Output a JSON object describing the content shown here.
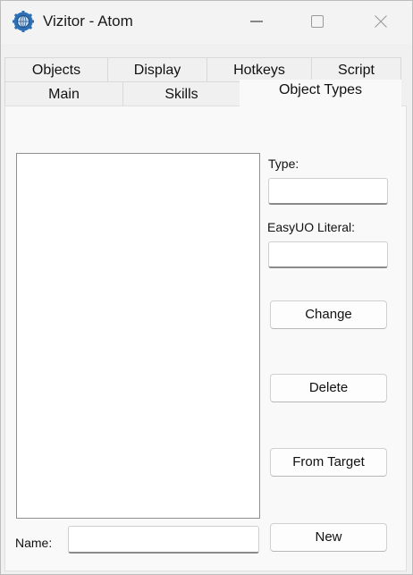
{
  "window": {
    "title": "Vizitor - Atom",
    "app_icon": "gear-globe-icon",
    "controls": [
      "minimize-icon",
      "maximize-icon",
      "close-icon"
    ]
  },
  "tabs": {
    "row_back": [
      {
        "label": "Objects"
      },
      {
        "label": "Display"
      },
      {
        "label": "Hotkeys"
      },
      {
        "label": "Script"
      }
    ],
    "row_front": [
      {
        "label": "Main"
      },
      {
        "label": "Skills"
      },
      {
        "label": "Object Types",
        "active": true
      }
    ]
  },
  "object_types": {
    "type_label": "Type:",
    "type_value": "",
    "literal_label": "EasyUO Literal:",
    "literal_value": "",
    "change_label": "Change",
    "delete_label": "Delete",
    "from_target_label": "From Target",
    "new_label": "New",
    "name_label": "Name:",
    "name_value": "",
    "list_items": []
  },
  "colors": {
    "window_bg": "#f3f3f3",
    "panel_bg": "#f9f9f9",
    "icon_blue": "#2f6fb4"
  }
}
